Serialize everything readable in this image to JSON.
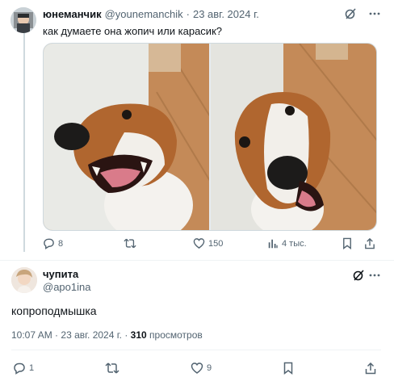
{
  "parent_tweet": {
    "display_name": "юнеманчик",
    "handle": "@younemanchik",
    "separator": "·",
    "date": "23 авг. 2024 г.",
    "text": "как думаете она жопич или карасик?",
    "media": [
      {
        "icon": "dog-photo-left"
      },
      {
        "icon": "dog-photo-right"
      }
    ],
    "actions": {
      "replies": "8",
      "reposts": "",
      "likes": "150",
      "views": "4 тыс."
    }
  },
  "reply_tweet": {
    "display_name": "чупита",
    "handle": "@apo1ina",
    "text": "копроподмышка",
    "time": "10:07 AM",
    "separator": "·",
    "date": "23 авг. 2024 г.",
    "views_count": "310",
    "views_label": "просмотров",
    "actions": {
      "replies": "1",
      "reposts": "",
      "likes": "9"
    }
  },
  "colors": {
    "text": "#0f1419",
    "muted": "#536471",
    "divider": "#eff3f4",
    "thread_line": "#cfd9de"
  }
}
